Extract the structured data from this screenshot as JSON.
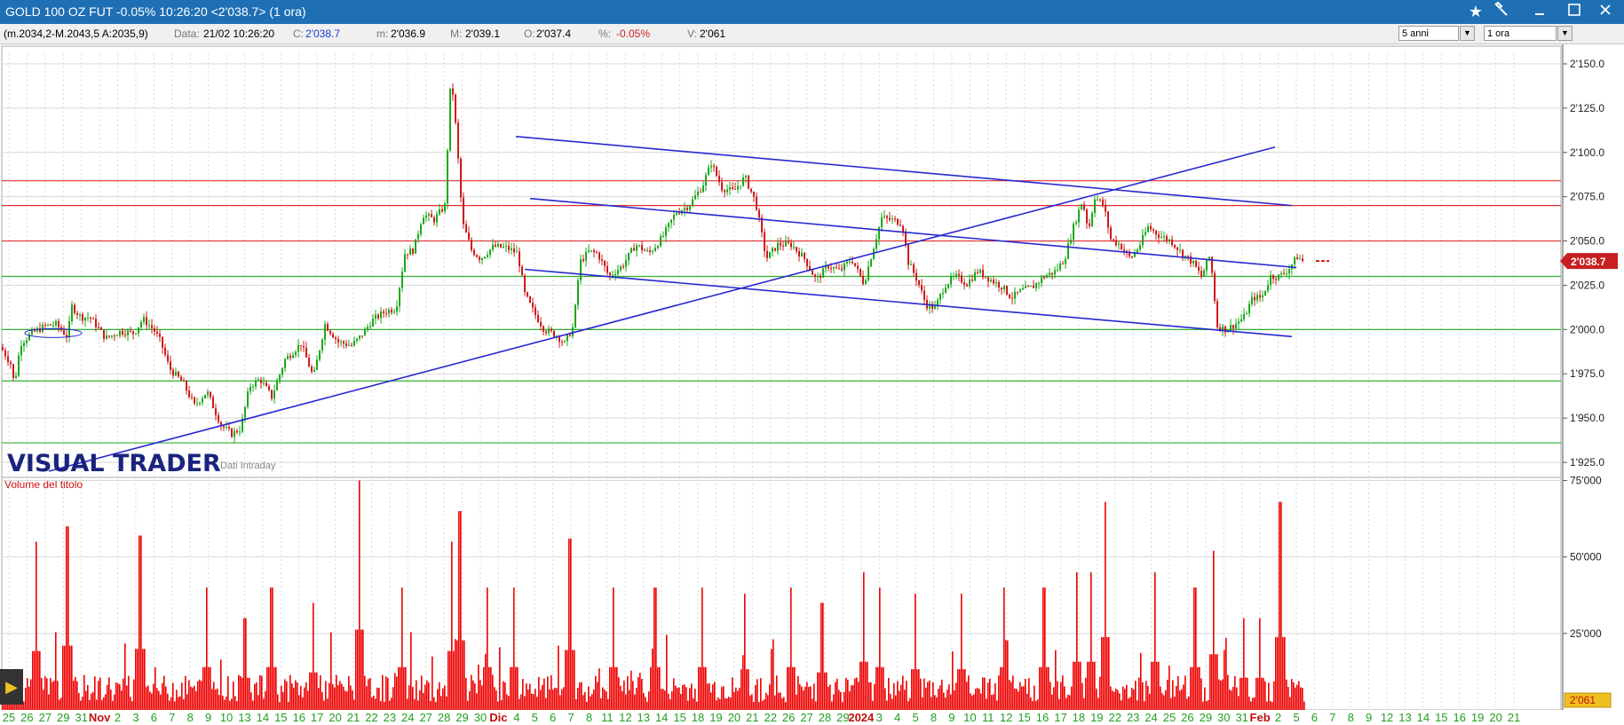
{
  "window": {
    "title": "GOLD 100 OZ FUT -0.05% 10:26:20  <2'038.7>  (1 ora)"
  },
  "infobar": {
    "range": "(m.2034,2-M.2043,5 A:2035,9)",
    "date_label": "Data:",
    "date_value": "21/02 10:26:20",
    "close_label": "C:",
    "close_value": "2'038.7",
    "min_label": "m:",
    "min_value": "2'036.9",
    "max_label": "M:",
    "max_value": "2'039.1",
    "open_label": "O:",
    "open_value": "2'037.4",
    "pct_label": "%:",
    "pct_value": "-0.05%",
    "vol_label": "V:",
    "vol_value": "2'061",
    "period_select": "5 anni",
    "interval_select": "1 ora"
  },
  "colors": {
    "title_bar": "#1f6fb4",
    "up_candle": "#1aa81a",
    "down_candle": "#d01818",
    "trendline": "#2828d0",
    "resistance": "#e03030",
    "support": "#30b030",
    "volume": "#ee0000",
    "last_price_tag": "#c82020"
  },
  "icons": {
    "favorite": "star-icon",
    "tools": "hammer-icon",
    "minimize": "minimize-icon",
    "maximize": "maximize-icon",
    "close": "close-icon",
    "play": "play-icon"
  },
  "chart_data": {
    "type": "candlestick",
    "instrument": "GOLD 100 OZ FUT",
    "interval": "1 ora",
    "watermark": "VISUAL TRADER",
    "watermark_sub": "Dati Intraday",
    "last_price": 2038.7,
    "last_price_label": "2'038.7",
    "price_axis": {
      "ylim": [
        1918,
        2156
      ],
      "ticks": [
        1925,
        1950,
        1975,
        2000,
        2025,
        2050,
        2075,
        2100,
        2125,
        2150
      ],
      "tick_labels": [
        "1'925.0",
        "1'950.0",
        "1'975.0",
        "2'000.0",
        "2'025.0",
        "2'050.0",
        "2'075.0",
        "2'100.0",
        "2'125.0",
        "2'150.0"
      ]
    },
    "x_labels": [
      "25",
      "26",
      "27",
      "29",
      "31",
      "Nov",
      "2",
      "3",
      "6",
      "7",
      "8",
      "9",
      "10",
      "13",
      "14",
      "15",
      "16",
      "17",
      "20",
      "21",
      "22",
      "23",
      "24",
      "27",
      "28",
      "29",
      "30",
      "Dic",
      "4",
      "5",
      "6",
      "7",
      "8",
      "11",
      "12",
      "13",
      "14",
      "15",
      "18",
      "19",
      "20",
      "21",
      "22",
      "26",
      "27",
      "28",
      "29",
      "2024",
      "3",
      "4",
      "5",
      "8",
      "9",
      "10",
      "11",
      "12",
      "15",
      "16",
      "17",
      "18",
      "19",
      "22",
      "23",
      "24",
      "25",
      "26",
      "29",
      "30",
      "31",
      "Feb",
      "2",
      "5",
      "6",
      "7",
      "8",
      "9",
      "12",
      "13",
      "14",
      "15",
      "16",
      "19",
      "20",
      "21"
    ],
    "price_path": [
      [
        0,
        1990
      ],
      [
        12,
        1980
      ],
      [
        15,
        1968
      ],
      [
        22,
        1992
      ],
      [
        35,
        1998
      ],
      [
        50,
        2002
      ],
      [
        62,
        2003
      ],
      [
        75,
        1996
      ],
      [
        80,
        2013
      ],
      [
        90,
        2007
      ],
      [
        100,
        2007
      ],
      [
        108,
        2002
      ],
      [
        118,
        1995
      ],
      [
        135,
        1999
      ],
      [
        150,
        1998
      ],
      [
        160,
        2006
      ],
      [
        172,
        2000
      ],
      [
        180,
        1993
      ],
      [
        190,
        1978
      ],
      [
        205,
        1970
      ],
      [
        218,
        1957
      ],
      [
        232,
        1965
      ],
      [
        248,
        1946
      ],
      [
        260,
        1941
      ],
      [
        270,
        1944
      ],
      [
        280,
        1968
      ],
      [
        292,
        1972
      ],
      [
        305,
        1962
      ],
      [
        320,
        1983
      ],
      [
        338,
        1992
      ],
      [
        352,
        1973
      ],
      [
        365,
        2003
      ],
      [
        380,
        1993
      ],
      [
        395,
        1991
      ],
      [
        405,
        1996
      ],
      [
        418,
        2005
      ],
      [
        432,
        2010
      ],
      [
        445,
        2012
      ],
      [
        455,
        2043
      ],
      [
        465,
        2045
      ],
      [
        475,
        2065
      ],
      [
        488,
        2062
      ],
      [
        500,
        2070
      ],
      [
        507,
        2145
      ],
      [
        513,
        2110
      ],
      [
        520,
        2060
      ],
      [
        530,
        2045
      ],
      [
        540,
        2040
      ],
      [
        555,
        2047
      ],
      [
        570,
        2046
      ],
      [
        582,
        2043
      ],
      [
        590,
        2020
      ],
      [
        600,
        2010
      ],
      [
        612,
        2000
      ],
      [
        625,
        1997
      ],
      [
        635,
        1992
      ],
      [
        645,
        2002
      ],
      [
        652,
        2038
      ],
      [
        662,
        2044
      ],
      [
        672,
        2043
      ],
      [
        685,
        2030
      ],
      [
        700,
        2036
      ],
      [
        715,
        2048
      ],
      [
        730,
        2043
      ],
      [
        745,
        2052
      ],
      [
        760,
        2066
      ],
      [
        775,
        2070
      ],
      [
        790,
        2081
      ],
      [
        800,
        2094
      ],
      [
        812,
        2080
      ],
      [
        825,
        2078
      ],
      [
        838,
        2086
      ],
      [
        850,
        2072
      ],
      [
        862,
        2040
      ],
      [
        875,
        2048
      ],
      [
        890,
        2048
      ],
      [
        905,
        2040
      ],
      [
        918,
        2028
      ],
      [
        932,
        2036
      ],
      [
        945,
        2033
      ],
      [
        958,
        2040
      ],
      [
        972,
        2026
      ],
      [
        982,
        2045
      ],
      [
        992,
        2063
      ],
      [
        1003,
        2062
      ],
      [
        1015,
        2060
      ],
      [
        1022,
        2038
      ],
      [
        1032,
        2028
      ],
      [
        1042,
        2014
      ],
      [
        1052,
        2012
      ],
      [
        1063,
        2025
      ],
      [
        1075,
        2030
      ],
      [
        1088,
        2026
      ],
      [
        1100,
        2033
      ],
      [
        1115,
        2028
      ],
      [
        1128,
        2024
      ],
      [
        1138,
        2018
      ],
      [
        1150,
        2022
      ],
      [
        1162,
        2024
      ],
      [
        1175,
        2030
      ],
      [
        1188,
        2033
      ],
      [
        1198,
        2040
      ],
      [
        1208,
        2058
      ],
      [
        1218,
        2073
      ],
      [
        1225,
        2056
      ],
      [
        1232,
        2075
      ],
      [
        1242,
        2070
      ],
      [
        1250,
        2051
      ],
      [
        1260,
        2048
      ],
      [
        1272,
        2040
      ],
      [
        1282,
        2047
      ],
      [
        1292,
        2058
      ],
      [
        1305,
        2053
      ],
      [
        1318,
        2050
      ],
      [
        1330,
        2043
      ],
      [
        1342,
        2038
      ],
      [
        1352,
        2030
      ],
      [
        1362,
        2042
      ],
      [
        1370,
        2002
      ],
      [
        1380,
        2000
      ],
      [
        1390,
        2003
      ],
      [
        1400,
        2007
      ],
      [
        1410,
        2018
      ],
      [
        1420,
        2018
      ],
      [
        1430,
        2030
      ],
      [
        1440,
        2030
      ],
      [
        1450,
        2034
      ],
      [
        1460,
        2041
      ],
      [
        1468,
        2038
      ]
    ]
  },
  "volume_data": {
    "title": "Volume del titolo",
    "ylim": [
      0,
      76000
    ],
    "ticks": [
      25000,
      50000,
      75000
    ],
    "tick_labels": [
      "25'000",
      "50'000",
      "75'000"
    ],
    "last_volume_label": "2'061",
    "spikes": [
      [
        40,
        55000
      ],
      [
        75,
        60000
      ],
      [
        157,
        57000
      ],
      [
        232,
        40000
      ],
      [
        275,
        30000
      ],
      [
        305,
        40000
      ],
      [
        352,
        35000
      ],
      [
        404,
        75000
      ],
      [
        452,
        40000
      ],
      [
        508,
        55000
      ],
      [
        517,
        65000
      ],
      [
        548,
        40000
      ],
      [
        578,
        40000
      ],
      [
        641,
        56000
      ],
      [
        690,
        40000
      ],
      [
        737,
        40000
      ],
      [
        790,
        40000
      ],
      [
        838,
        38000
      ],
      [
        890,
        40000
      ],
      [
        925,
        35000
      ],
      [
        972,
        45000
      ],
      [
        990,
        40000
      ],
      [
        1030,
        38000
      ],
      [
        1082,
        38000
      ],
      [
        1130,
        40000
      ],
      [
        1175,
        40000
      ],
      [
        1212,
        45000
      ],
      [
        1228,
        45000
      ],
      [
        1244,
        68000
      ],
      [
        1300,
        45000
      ],
      [
        1345,
        40000
      ],
      [
        1366,
        52000
      ],
      [
        1400,
        30000
      ],
      [
        1418,
        30000
      ],
      [
        1441,
        68000
      ]
    ]
  },
  "drawings": {
    "trendlines": [
      {
        "x1": 55,
        "p1": 1920,
        "x2": 1436,
        "p2": 2103
      },
      {
        "x1": 581,
        "p1": 2109,
        "x2": 1455,
        "p2": 2070
      },
      {
        "x1": 597,
        "p1": 2074,
        "x2": 1460,
        "p2": 2035
      },
      {
        "x1": 591,
        "p1": 2034,
        "x2": 1455,
        "p2": 1996
      }
    ],
    "resistance_levels": [
      2084,
      2070,
      2050
    ],
    "support_levels": [
      2030,
      2000,
      1971,
      1936
    ]
  }
}
